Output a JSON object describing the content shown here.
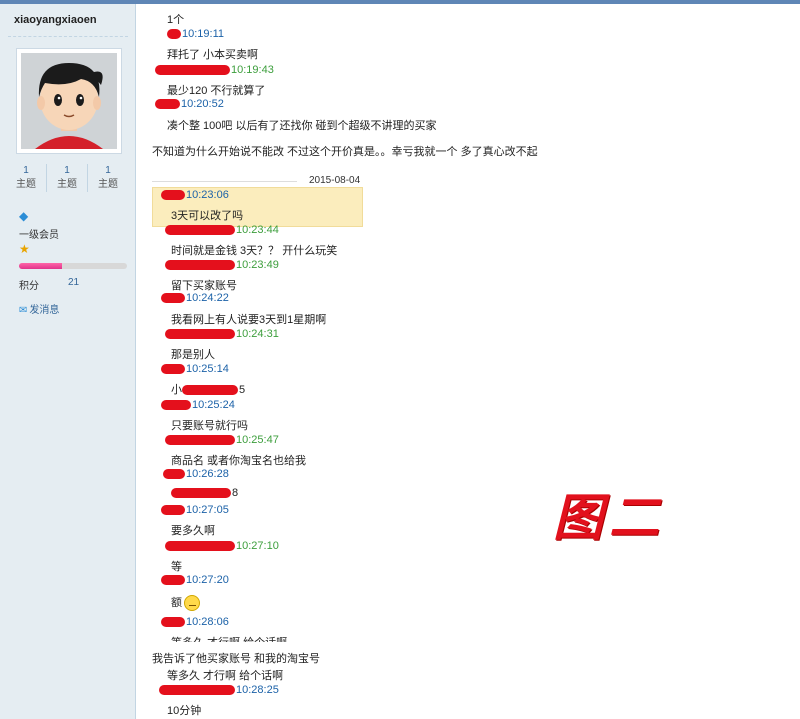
{
  "sidebar": {
    "username": "xiaoyangxiaoen",
    "stats": [
      {
        "value": "1",
        "label": "主题"
      },
      {
        "value": "1",
        "label": "主题"
      },
      {
        "value": "1",
        "label": "主题"
      }
    ],
    "level": "一级会员",
    "progress_fraction": 0.4,
    "points_label": "积分",
    "points_value": "21",
    "send_message": "发消息"
  },
  "chat": {
    "top_count": "1个",
    "date": "2015-08-04",
    "messages": [
      {
        "time": "10:19:11",
        "text": "拜托了 小本买卖啊"
      },
      {
        "time": "10:19:43",
        "text": "最少120 不行就算了"
      },
      {
        "time": "10:20:52",
        "text": "凑个整 100吧 以后有了还找你 碰到个超级不讲理的买家"
      },
      {
        "time": "10:23:06",
        "text": "3天可以改了吗"
      },
      {
        "time": "10:23:44",
        "text": "时间就是金钱 3天？？ 开什么玩笑"
      },
      {
        "time": "10:23:49",
        "text": "留下买家账号"
      },
      {
        "time": "10:24:22",
        "text": "我看网上有人说要3天到1星期啊"
      },
      {
        "time": "10:24:31",
        "text": "那是别人"
      },
      {
        "time": "10:25:14",
        "text": "小",
        "tail": "5"
      },
      {
        "time": "10:25:24",
        "text": "只要账号就行吗"
      },
      {
        "time": "10:25:47",
        "text": "商品名 或者你淘宝名也给我"
      },
      {
        "time": "10:26:28",
        "text": "",
        "tail": "8"
      },
      {
        "time": "10:27:05",
        "text": "要多久啊"
      },
      {
        "time": "10:27:10",
        "text": "等"
      },
      {
        "time": "10:27:20",
        "text": "额"
      },
      {
        "time": "10:28:06",
        "text": "等多久 才行啊  给个话啊"
      },
      {
        "time": "10:28:25",
        "text": "10分钟"
      }
    ],
    "comment_1": "不知道为什么开始说不能改 不过这个开价真是。。幸亏我就一个 多了真心改不起",
    "comment_2": "我告诉了他买家账号 和我的淘宝号",
    "repeat_text": "等多久 才行啊  给个话啊",
    "figure_label": "图二"
  },
  "colors": {
    "sidebar_bg": "#e5edf2",
    "time_green": "#3c9e3c",
    "time_blue": "#1c62a8",
    "redaction": "#e4101c",
    "highlight": "#fbedbd"
  }
}
